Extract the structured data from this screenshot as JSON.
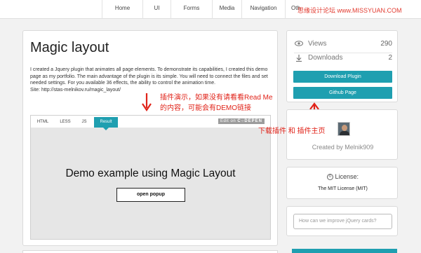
{
  "nav": {
    "items": [
      "Home",
      "UI",
      "Forms",
      "Media",
      "Navigation",
      "Oth"
    ]
  },
  "watermark": "思缘设计论坛 www.MISSYUAN.COM",
  "main": {
    "title": "Magic layout",
    "description": "I created a Jquery plugin that animates all page elements. To demonstrate its capabilities, I created this demo page as my portfolio. The main advantage of the plugin is its simple. You will need to connect the files and set needed settings. For you available 36 effects, the ability to control the animation time.",
    "site": "Site: http://stas-melnikov.ru/magic_layout/"
  },
  "embed": {
    "tabs": [
      "HTML",
      "LESS",
      "JS",
      "Result"
    ],
    "active_tab": "Result",
    "edit_on": "Edit on",
    "codepen": "C○DEPEN",
    "demo_title": "Demo example using Magic Layout",
    "demo_button": "open popup"
  },
  "annotations": {
    "embed_note_line1": "插件演示，如果没有请看看Read Me",
    "embed_note_line2": "的内容，可能会有DEMO链接",
    "buttons_note": "下载插件 和 插件主页"
  },
  "sidebar": {
    "views_label": "Views",
    "views_value": "290",
    "downloads_label": "Downloads",
    "downloads_value": "2",
    "download_button": "Download Plugin",
    "github_button": "Github Page",
    "created_by": "Created by Melnik909",
    "license_title": "License:",
    "license_text": "The MIT License (MIT)",
    "feedback_placeholder": "How can we improve jQuery cards?"
  },
  "colors": {
    "accent": "#1f9fb0",
    "annotation": "#e02319"
  }
}
